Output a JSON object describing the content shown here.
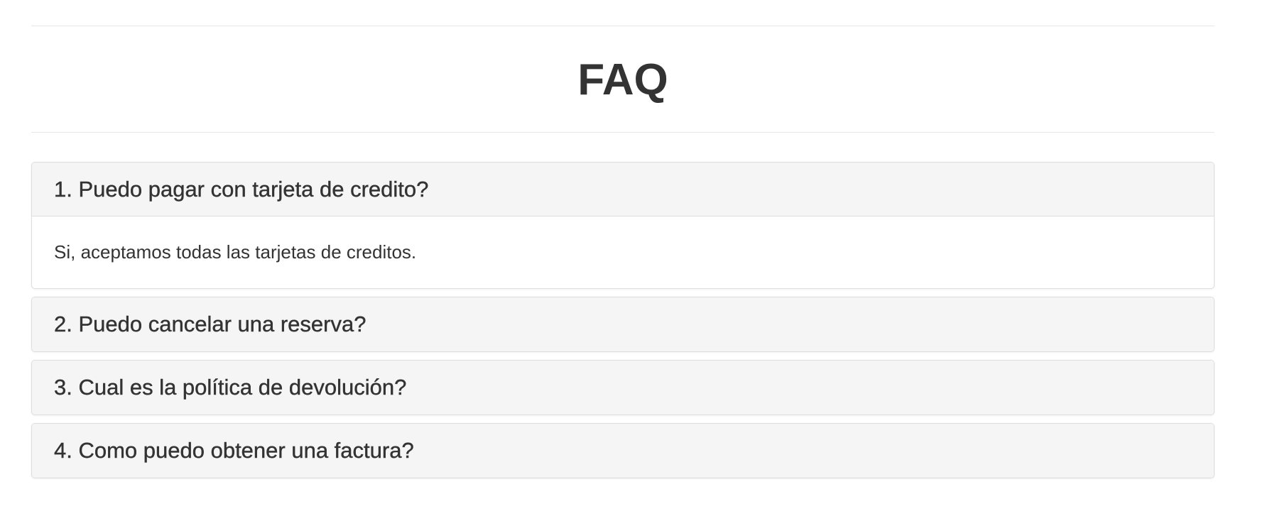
{
  "page": {
    "title": "FAQ"
  },
  "faq": [
    {
      "question": "1. Puedo pagar con tarjeta de credito?",
      "answer": "Si, aceptamos todas las tarjetas de creditos.",
      "expanded": true
    },
    {
      "question": "2. Puedo cancelar una reserva?",
      "expanded": false
    },
    {
      "question": "3. Cual es la política de devolución?",
      "expanded": false
    },
    {
      "question": "4. Como puedo obtener una factura?",
      "expanded": false
    }
  ],
  "colors": {
    "text": "#333333",
    "panel_heading_bg": "#f5f5f5",
    "panel_border": "#dddddd",
    "divider": "#e7e7e7"
  }
}
